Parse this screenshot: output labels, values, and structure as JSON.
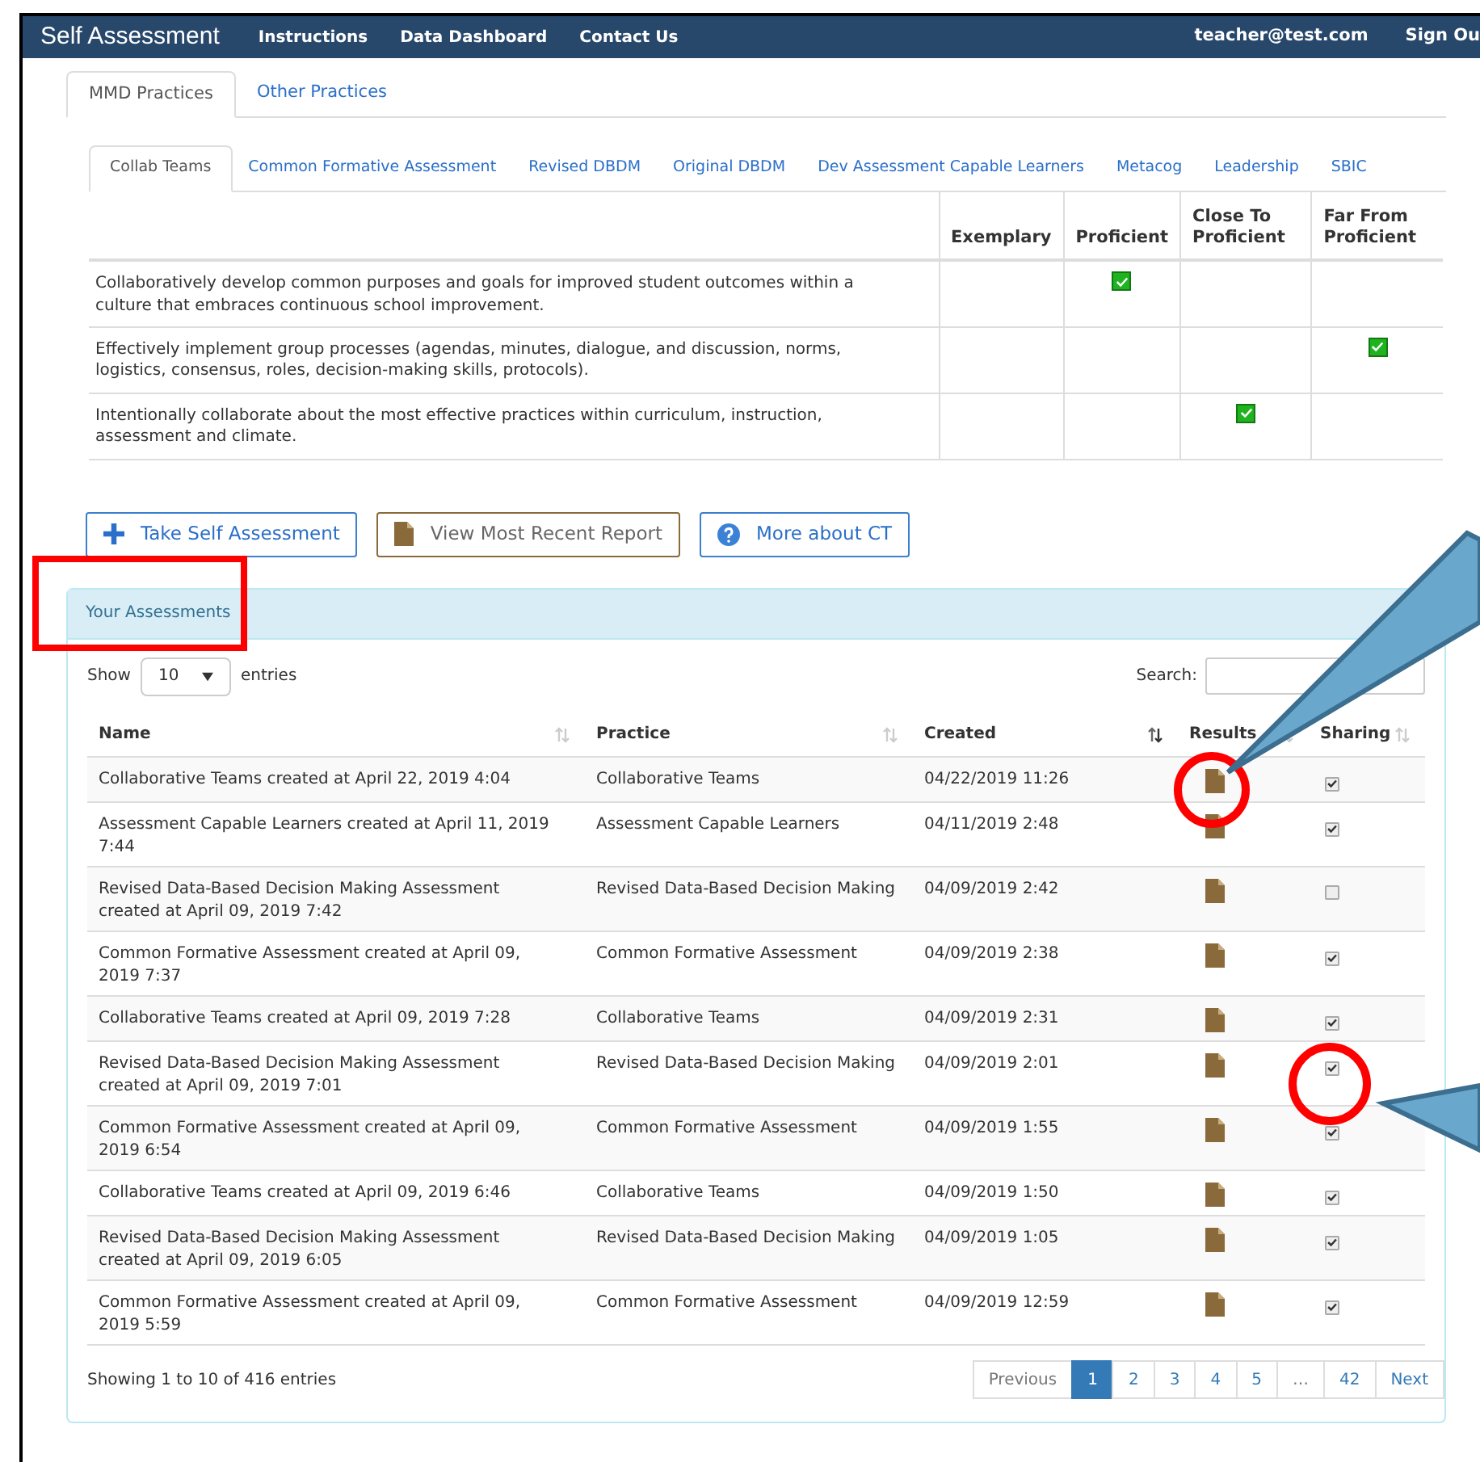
{
  "navbar": {
    "brand": "Self Assessment",
    "links": [
      "Instructions",
      "Data Dashboard",
      "Contact Us"
    ],
    "user": "teacher@test.com",
    "sign_out": "Sign Ou"
  },
  "tabs": [
    {
      "label": "MMD Practices",
      "selected": true
    },
    {
      "label": "Other Practices",
      "selected": false
    }
  ],
  "practice_tabs": [
    {
      "label": "Collab Teams",
      "selected": true
    },
    {
      "label": "Common Formative Assessment",
      "selected": false
    },
    {
      "label": "Revised DBDM",
      "selected": false
    },
    {
      "label": "Original DBDM",
      "selected": false
    },
    {
      "label": "Dev Assessment Capable Learners",
      "selected": false
    },
    {
      "label": "Metacog",
      "selected": false
    },
    {
      "label": "Leadership",
      "selected": false
    },
    {
      "label": "SBIC",
      "selected": false
    }
  ],
  "rating_table": {
    "columns": [
      "Exemplary",
      "Proficient",
      "Close To Proficient",
      "Far From Proficient"
    ],
    "rows": [
      {
        "text": "Collaboratively develop common purposes and goals for improved student outcomes within a culture that embraces continuous school improvement.",
        "checked": [
          false,
          true,
          false,
          false
        ]
      },
      {
        "text": "Effectively implement group processes (agendas, minutes, dialogue, and discussion, norms, logistics, consensus, roles, decision-making skills, protocols).",
        "checked": [
          false,
          false,
          false,
          true
        ]
      },
      {
        "text": "Intentionally collaborate about the most effective practices within curriculum, instruction, assessment and climate.",
        "checked": [
          false,
          false,
          true,
          false
        ]
      }
    ]
  },
  "buttons": [
    {
      "label": "Take Self Assessment",
      "kind": "plus"
    },
    {
      "label": "View Most Recent Report",
      "kind": "report"
    },
    {
      "label": "More about CT",
      "kind": "info"
    }
  ],
  "assessments": {
    "title": "Your Assessments",
    "show_label": "Show",
    "page_size": "10",
    "entries_label": "entries",
    "search_label": "Search:",
    "columns": [
      {
        "label": "Name",
        "sorted": false
      },
      {
        "label": "Practice",
        "sorted": false
      },
      {
        "label": "Created",
        "sorted": true
      },
      {
        "label": "Results",
        "sorted": false
      },
      {
        "label": "Sharing",
        "sorted": false
      }
    ],
    "rows": [
      {
        "name": "Collaborative Teams created at April 22, 2019 4:04",
        "practice": "Collaborative Teams",
        "created": "04/22/2019 11:26",
        "sharing": true
      },
      {
        "name": "Assessment Capable Learners created at April 11, 2019 7:44",
        "practice": "Assessment Capable Learners",
        "created": "04/11/2019 2:48",
        "sharing": true
      },
      {
        "name": "Revised Data-Based Decision Making Assessment created at April 09, 2019 7:42",
        "practice": "Revised Data-Based Decision Making",
        "created": "04/09/2019 2:42",
        "sharing": false
      },
      {
        "name": "Common Formative Assessment created at April 09, 2019 7:37",
        "practice": "Common Formative Assessment",
        "created": "04/09/2019 2:38",
        "sharing": true
      },
      {
        "name": "Collaborative Teams created at April 09, 2019 7:28",
        "practice": "Collaborative Teams",
        "created": "04/09/2019 2:31",
        "sharing": true
      },
      {
        "name": "Revised Data-Based Decision Making Assessment created at April 09, 2019 7:01",
        "practice": "Revised Data-Based Decision Making",
        "created": "04/09/2019 2:01",
        "sharing": true
      },
      {
        "name": "Common Formative Assessment created at April 09, 2019 6:54",
        "practice": "Common Formative Assessment",
        "created": "04/09/2019 1:55",
        "sharing": true
      },
      {
        "name": "Collaborative Teams created at April 09, 2019 6:46",
        "practice": "Collaborative Teams",
        "created": "04/09/2019 1:50",
        "sharing": true
      },
      {
        "name": "Revised Data-Based Decision Making Assessment created at April 09, 2019 6:05",
        "practice": "Revised Data-Based Decision Making",
        "created": "04/09/2019 1:05",
        "sharing": true
      },
      {
        "name": "Common Formative Assessment created at April 09, 2019 5:59",
        "practice": "Common Formative Assessment",
        "created": "04/09/2019 12:59",
        "sharing": true
      }
    ],
    "info": "Showing 1 to 10 of 416 entries",
    "pages": [
      {
        "label": "Previous",
        "selected": false,
        "disabled": true
      },
      {
        "label": "1",
        "selected": true,
        "disabled": false
      },
      {
        "label": "2",
        "selected": false,
        "disabled": false
      },
      {
        "label": "3",
        "selected": false,
        "disabled": false
      },
      {
        "label": "4",
        "selected": false,
        "disabled": false
      },
      {
        "label": "5",
        "selected": false,
        "disabled": false
      },
      {
        "label": "…",
        "selected": false,
        "disabled": true
      },
      {
        "label": "42",
        "selected": false,
        "disabled": false
      },
      {
        "label": "Next",
        "selected": false,
        "disabled": false
      }
    ]
  }
}
